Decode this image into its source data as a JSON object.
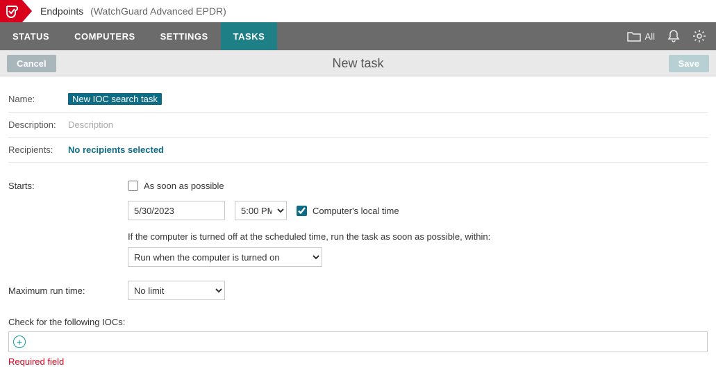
{
  "brand": {
    "title": "Endpoints",
    "sub": "(WatchGuard Advanced EPDR)"
  },
  "nav": {
    "items": [
      {
        "label": "STATUS"
      },
      {
        "label": "COMPUTERS"
      },
      {
        "label": "SETTINGS"
      },
      {
        "label": "TASKS"
      }
    ],
    "all_label": "All"
  },
  "actionbar": {
    "cancel": "Cancel",
    "save": "Save",
    "title": "New task"
  },
  "form": {
    "name_label": "Name:",
    "name_value": "New IOC search task",
    "desc_label": "Description:",
    "desc_placeholder": "Description",
    "recip_label": "Recipients:",
    "recip_value": "No recipients selected"
  },
  "schedule": {
    "starts_label": "Starts:",
    "asap_label": "As soon as possible",
    "date_value": "5/30/2023",
    "time_value": "5:00 PM",
    "localtime_label": "Computer's local time",
    "off_note": "If the computer is turned off at the scheduled time, run the task as soon as possible, within:",
    "run_option": "Run when the computer is turned on",
    "max_label": "Maximum run time:",
    "max_value": "No limit"
  },
  "ioc": {
    "label": "Check for the following IOCs:",
    "required": "Required field"
  }
}
